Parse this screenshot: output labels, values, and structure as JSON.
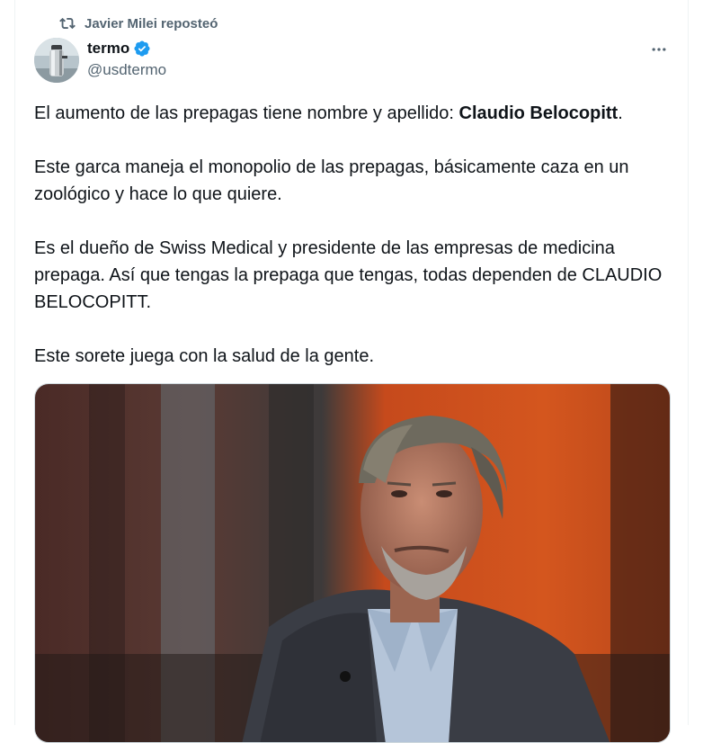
{
  "repost": {
    "icon": "repost-icon",
    "text": "Javier Milei reposteó"
  },
  "author": {
    "display_name": "termo",
    "handle": "@usdtermo",
    "verified": true,
    "verified_color": "#1d9bf0"
  },
  "more_icon": "more-dots-icon",
  "tweet": {
    "p1_before": "El aumento de las prepagas tiene nombre y apellido: ",
    "p1_bold": "Claudio Belocopitt",
    "p1_after": ".",
    "p2": "Este garca maneja el monopolio de las prepagas, básicamente caza en un zoológico y hace lo que quiere.",
    "p3": "Es el dueño de Swiss Medical y presidente de las empresas de medicina prepaga. Así que tengas la prepaga que tengas, todas dependen de CLAUDIO BELOCOPITT.",
    "p4": "Este sorete juega con la salud de la gente."
  },
  "colors": {
    "text": "#0f1419",
    "secondary": "#536471",
    "accent": "#1d9bf0"
  }
}
